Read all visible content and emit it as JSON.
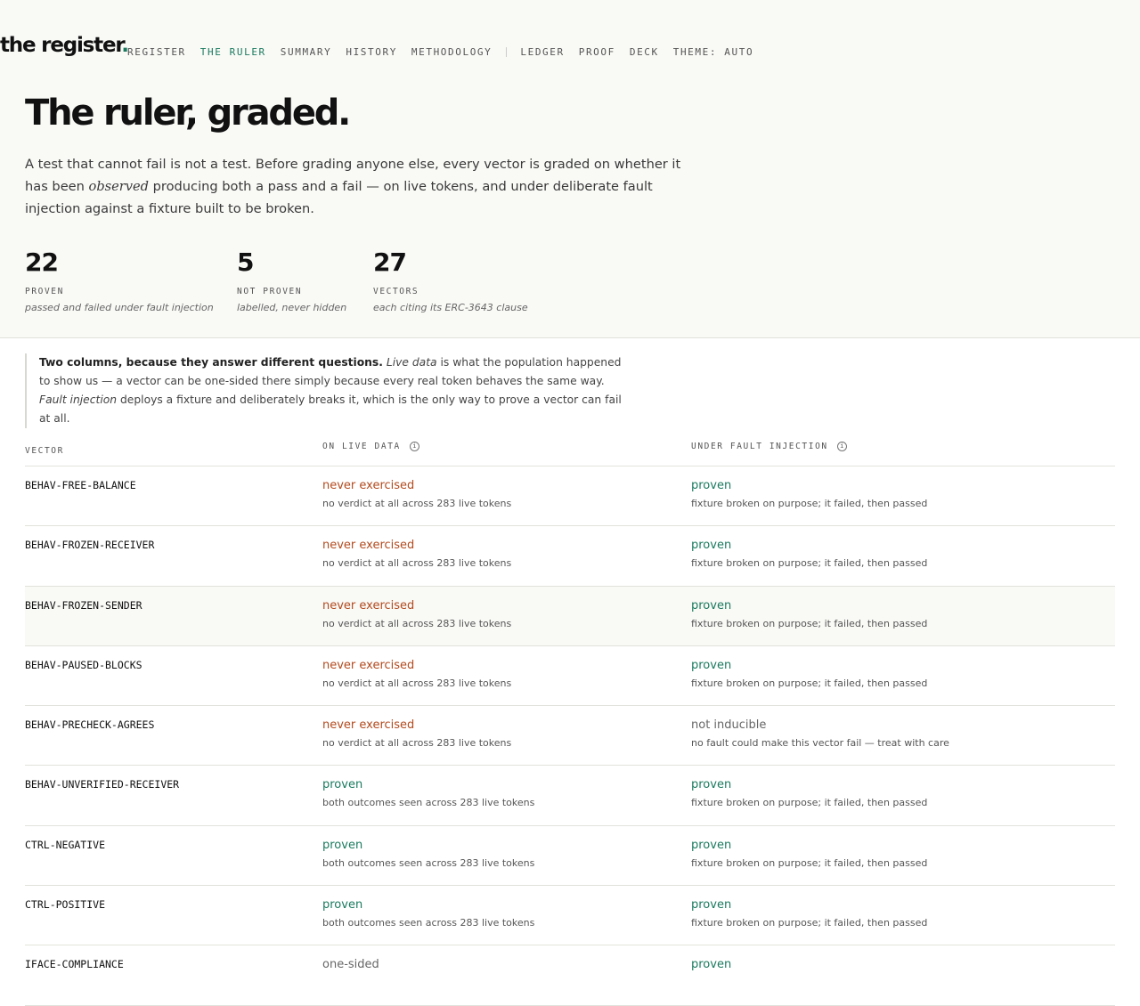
{
  "brand": {
    "name": "the register",
    "dot": "."
  },
  "nav": {
    "links": [
      "REGISTER",
      "THE RULER",
      "SUMMARY",
      "HISTORY",
      "METHODOLOGY"
    ],
    "links2": [
      "LEDGER",
      "PROOF",
      "DECK",
      "THEME: AUTO"
    ],
    "active": "THE RULER"
  },
  "page": {
    "title": "The ruler, graded.",
    "lead_1": "A test that cannot fail is not a test. Before grading anyone else, every vector is graded on whether it has been ",
    "lead_em": "observed",
    "lead_2": " producing both a pass and a fail — on live tokens, and under deliberate fault injection against a fixture built to be broken."
  },
  "stats": [
    {
      "num": "22",
      "label": "PROVEN",
      "sub": "passed and failed under fault injection"
    },
    {
      "num": "5",
      "label": "NOT PROVEN",
      "sub": "labelled, never hidden"
    },
    {
      "num": "27",
      "label": "VECTORS",
      "sub": "each citing its ERC-3643 clause"
    }
  ],
  "note": {
    "bold": "Two columns, because they answer different questions.",
    "em1": "Live data",
    "t1": " is what the population happened to show us — a vector can be one-sided there simply because every real token behaves the same way. ",
    "em2": "Fault injection",
    "t2": " deploys a fixture and deliberately breaks it, which is the only way to prove a vector can fail at all."
  },
  "table": {
    "headers": [
      "VECTOR",
      "ON LIVE DATA",
      "UNDER FAULT INJECTION"
    ],
    "rows": [
      {
        "vector": "BEHAV-FREE-BALANCE",
        "live": "never exercised",
        "live_kind": "never",
        "live_desc": "no verdict at all across 283 live tokens",
        "fault": "proven",
        "fault_kind": "proven",
        "fault_desc": "fixture broken on purpose; it failed, then passed"
      },
      {
        "vector": "BEHAV-FROZEN-RECEIVER",
        "live": "never exercised",
        "live_kind": "never",
        "live_desc": "no verdict at all across 283 live tokens",
        "fault": "proven",
        "fault_kind": "proven",
        "fault_desc": "fixture broken on purpose; it failed, then passed"
      },
      {
        "vector": "BEHAV-FROZEN-SENDER",
        "live": "never exercised",
        "live_kind": "never",
        "live_desc": "no verdict at all across 283 live tokens",
        "fault": "proven",
        "fault_kind": "proven",
        "fault_desc": "fixture broken on purpose; it failed, then passed",
        "highlight": true
      },
      {
        "vector": "BEHAV-PAUSED-BLOCKS",
        "live": "never exercised",
        "live_kind": "never",
        "live_desc": "no verdict at all across 283 live tokens",
        "fault": "proven",
        "fault_kind": "proven",
        "fault_desc": "fixture broken on purpose; it failed, then passed"
      },
      {
        "vector": "BEHAV-PRECHECK-AGREES",
        "live": "never exercised",
        "live_kind": "never",
        "live_desc": "no verdict at all across 283 live tokens",
        "fault": "not inducible",
        "fault_kind": "neutral",
        "fault_desc": "no fault could make this vector fail — treat with care"
      },
      {
        "vector": "BEHAV-UNVERIFIED-RECEIVER",
        "live": "proven",
        "live_kind": "proven",
        "live_desc": "both outcomes seen across 283 live tokens",
        "fault": "proven",
        "fault_kind": "proven",
        "fault_desc": "fixture broken on purpose; it failed, then passed"
      },
      {
        "vector": "CTRL-NEGATIVE",
        "live": "proven",
        "live_kind": "proven",
        "live_desc": "both outcomes seen across 283 live tokens",
        "fault": "proven",
        "fault_kind": "proven",
        "fault_desc": "fixture broken on purpose; it failed, then passed"
      },
      {
        "vector": "CTRL-POSITIVE",
        "live": "proven",
        "live_kind": "proven",
        "live_desc": "both outcomes seen across 283 live tokens",
        "fault": "proven",
        "fault_kind": "proven",
        "fault_desc": "fixture broken on purpose; it failed, then passed"
      },
      {
        "vector": "IFACE-COMPLIANCE",
        "live": "one-sided",
        "live_kind": "neutral",
        "live_desc": "",
        "fault": "proven",
        "fault_kind": "proven",
        "fault_desc": ""
      }
    ]
  }
}
